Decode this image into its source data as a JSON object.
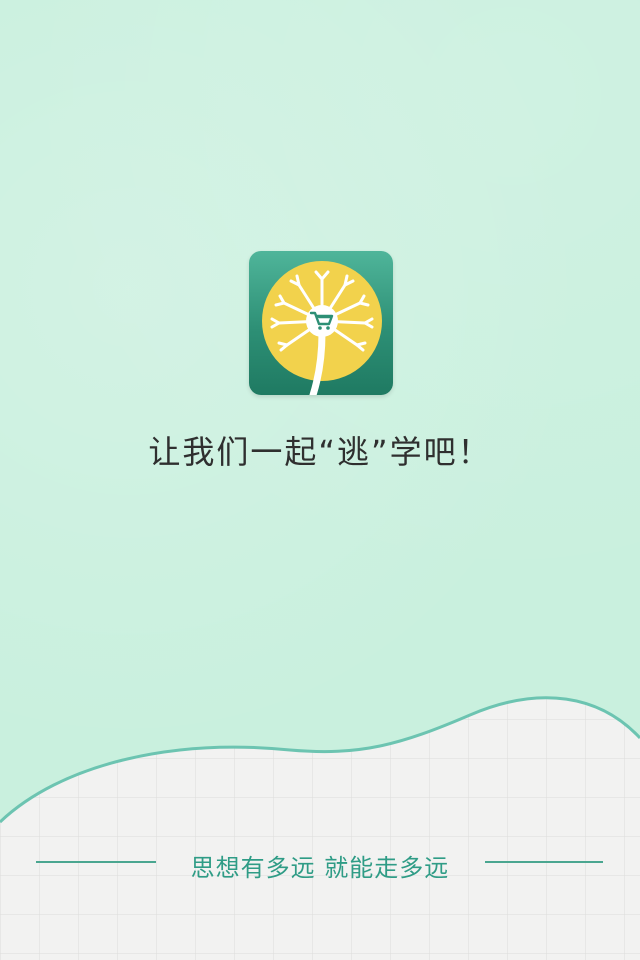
{
  "splash": {
    "tagline": "让我们一起“逃”学吧！",
    "slogan": "思想有多远  就能走多远"
  },
  "theme": {
    "background": "#c9f0de",
    "accent": "#2f9c86",
    "logo_yellow": "#f2d24c",
    "logo_green": "#2d8f75"
  },
  "icons": {
    "logo": "dandelion-cart-icon"
  }
}
